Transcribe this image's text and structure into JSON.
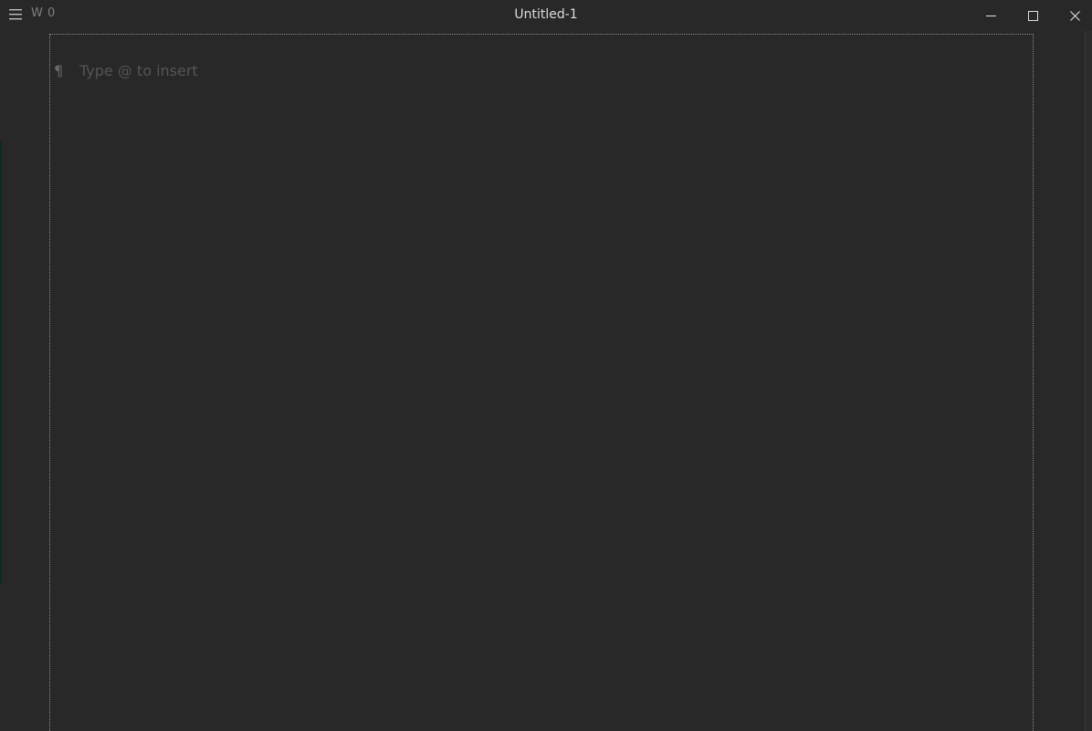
{
  "titlebar": {
    "word_count": "W 0",
    "title": "Untitled-1",
    "menu_icon": "hamburger-menu-icon",
    "minimize_icon": "minimize-icon",
    "maximize_icon": "maximize-icon",
    "close_icon": "close-icon"
  },
  "editor": {
    "paragraph_marker": "¶",
    "placeholder": "Type @ to insert"
  },
  "colors": {
    "background": "#282828",
    "title_text": "#dcdcdc",
    "muted_text": "#7d7d7d",
    "placeholder_text": "#555555",
    "frame_border": "#8a8a8a"
  }
}
